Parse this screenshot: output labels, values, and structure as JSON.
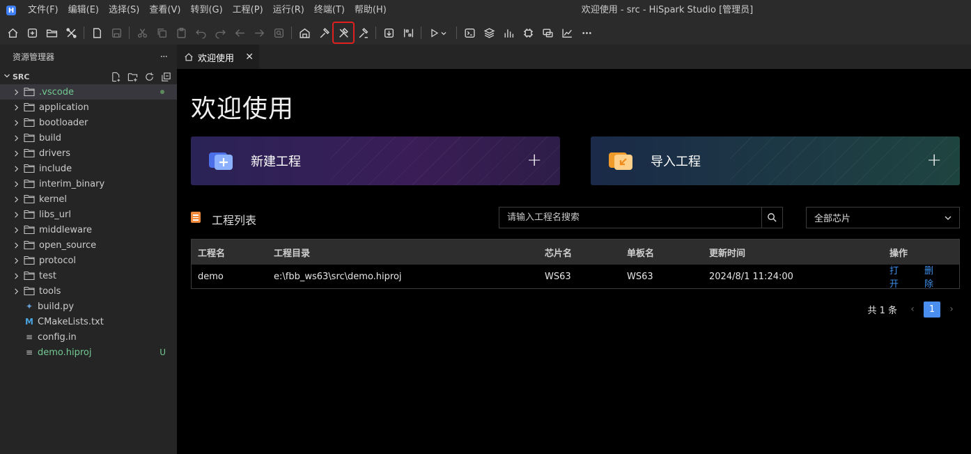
{
  "app": {
    "logo": "H",
    "window_title": "欢迎使用 - src - HiSpark Studio [管理员]"
  },
  "menu": [
    "文件(F)",
    "编辑(E)",
    "选择(S)",
    "查看(V)",
    "转到(G)",
    "工程(P)",
    "运行(R)",
    "终端(T)",
    "帮助(H)"
  ],
  "toolbar": {
    "icons": [
      "home-icon",
      "new-file-icon",
      "open-folder-icon",
      "tools-icon",
      "file-icon",
      "save-icon",
      "cut-icon",
      "copy-icon",
      "paste-icon",
      "undo-icon",
      "redo-icon",
      "back-icon",
      "forward-icon",
      "search-file-icon",
      "build-icon",
      "hammer-icon",
      "rebuild-icon",
      "clean-icon",
      "download-icon",
      "config-icon",
      "debug-icon",
      "terminal-icon",
      "layers-icon",
      "chart-icon",
      "chip-icon",
      "monitor-icon",
      "graph-icon",
      "more-icon"
    ],
    "highlighted": "rebuild-icon"
  },
  "explorer": {
    "title": "资源管理器",
    "more": "···",
    "root": "SRC",
    "items": [
      {
        "type": "folder",
        "name": ".vscode",
        "status": "dot",
        "color": "#73c991"
      },
      {
        "type": "folder",
        "name": "application"
      },
      {
        "type": "folder",
        "name": "bootloader"
      },
      {
        "type": "folder",
        "name": "build"
      },
      {
        "type": "folder",
        "name": "drivers"
      },
      {
        "type": "folder",
        "name": "include"
      },
      {
        "type": "folder",
        "name": "interim_binary"
      },
      {
        "type": "folder",
        "name": "kernel"
      },
      {
        "type": "folder",
        "name": "libs_url"
      },
      {
        "type": "folder",
        "name": "middleware"
      },
      {
        "type": "folder",
        "name": "open_source"
      },
      {
        "type": "folder",
        "name": "protocol"
      },
      {
        "type": "folder",
        "name": "test"
      },
      {
        "type": "folder",
        "name": "tools"
      },
      {
        "type": "file",
        "name": "build.py",
        "icon": "python-icon"
      },
      {
        "type": "file",
        "name": "CMakeLists.txt",
        "icon": "cmake-icon"
      },
      {
        "type": "file",
        "name": "config.in",
        "icon": "text-file-icon"
      },
      {
        "type": "file",
        "name": "demo.hiproj",
        "icon": "text-file-icon",
        "status": "U",
        "color": "#73c991"
      }
    ]
  },
  "tab": {
    "label": "欢迎使用",
    "close": "✕"
  },
  "welcome": {
    "title": "欢迎使用",
    "new_project": "新建工程",
    "import_project": "导入工程",
    "plus": "+",
    "list_title": "工程列表",
    "search_placeholder": "请输入工程名搜索",
    "chip_filter": "全部芯片",
    "table": {
      "headers": [
        "工程名",
        "工程目录",
        "芯片名",
        "单板名",
        "更新时间",
        "操作"
      ],
      "rows": [
        {
          "name": "demo",
          "dir": "e:\\fbb_ws63\\src\\demo.hiproj",
          "chip": "WS63",
          "board": "WS63",
          "time": "2024/8/1 11:24:00",
          "open": "打开",
          "delete": "删除"
        }
      ]
    },
    "pager": {
      "total": "共 1 条",
      "current": "1",
      "prev": "‹",
      "next": "›"
    }
  }
}
